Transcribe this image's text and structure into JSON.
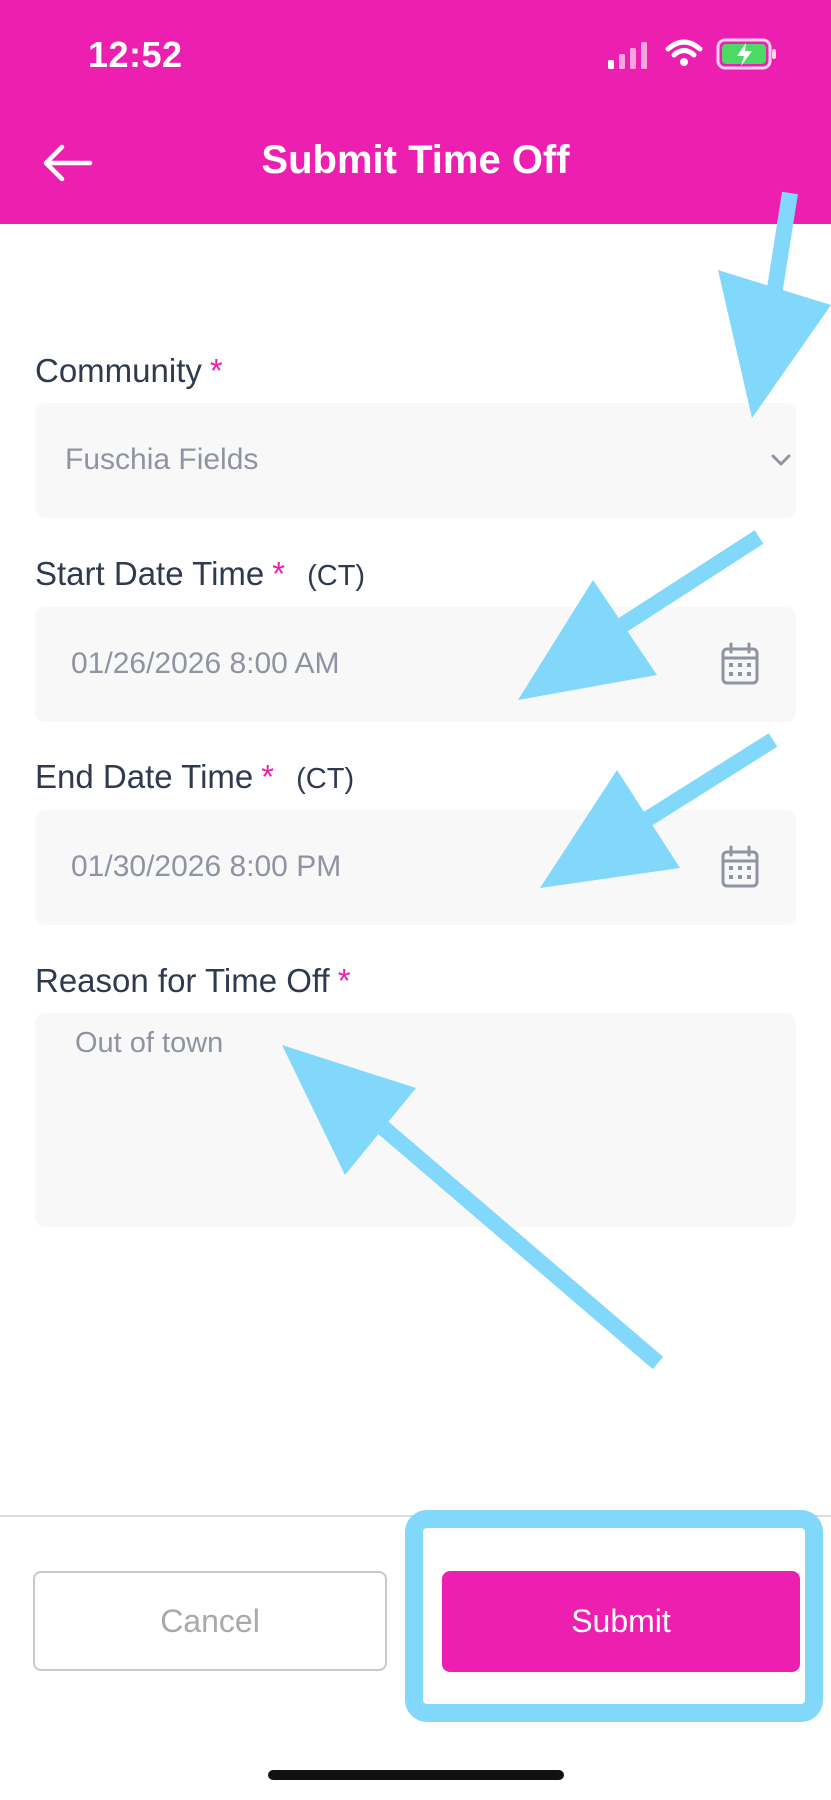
{
  "status_bar": {
    "time": "12:52"
  },
  "header": {
    "title": "Submit Time Off"
  },
  "form": {
    "community": {
      "label": "Community",
      "required_mark": "*",
      "value": "Fuschia Fields"
    },
    "start": {
      "label": "Start Date Time",
      "required_mark": "*",
      "timezone": "(CT)",
      "value": "01/26/2026 8:00 AM"
    },
    "end": {
      "label": "End Date Time",
      "required_mark": "*",
      "timezone": "(CT)",
      "value": "01/30/2026 8:00 PM"
    },
    "reason": {
      "label": "Reason for Time Off",
      "required_mark": "*",
      "value": "Out of town"
    }
  },
  "footer": {
    "cancel_label": "Cancel",
    "submit_label": "Submit"
  },
  "colors": {
    "brand": "#ec1fb1",
    "annotation": "#82d8fb",
    "field_bg": "#f8f8f8"
  },
  "icons": [
    "back-arrow-icon",
    "chevron-down-icon",
    "calendar-icon",
    "signal-icon",
    "wifi-icon",
    "battery-icon"
  ]
}
